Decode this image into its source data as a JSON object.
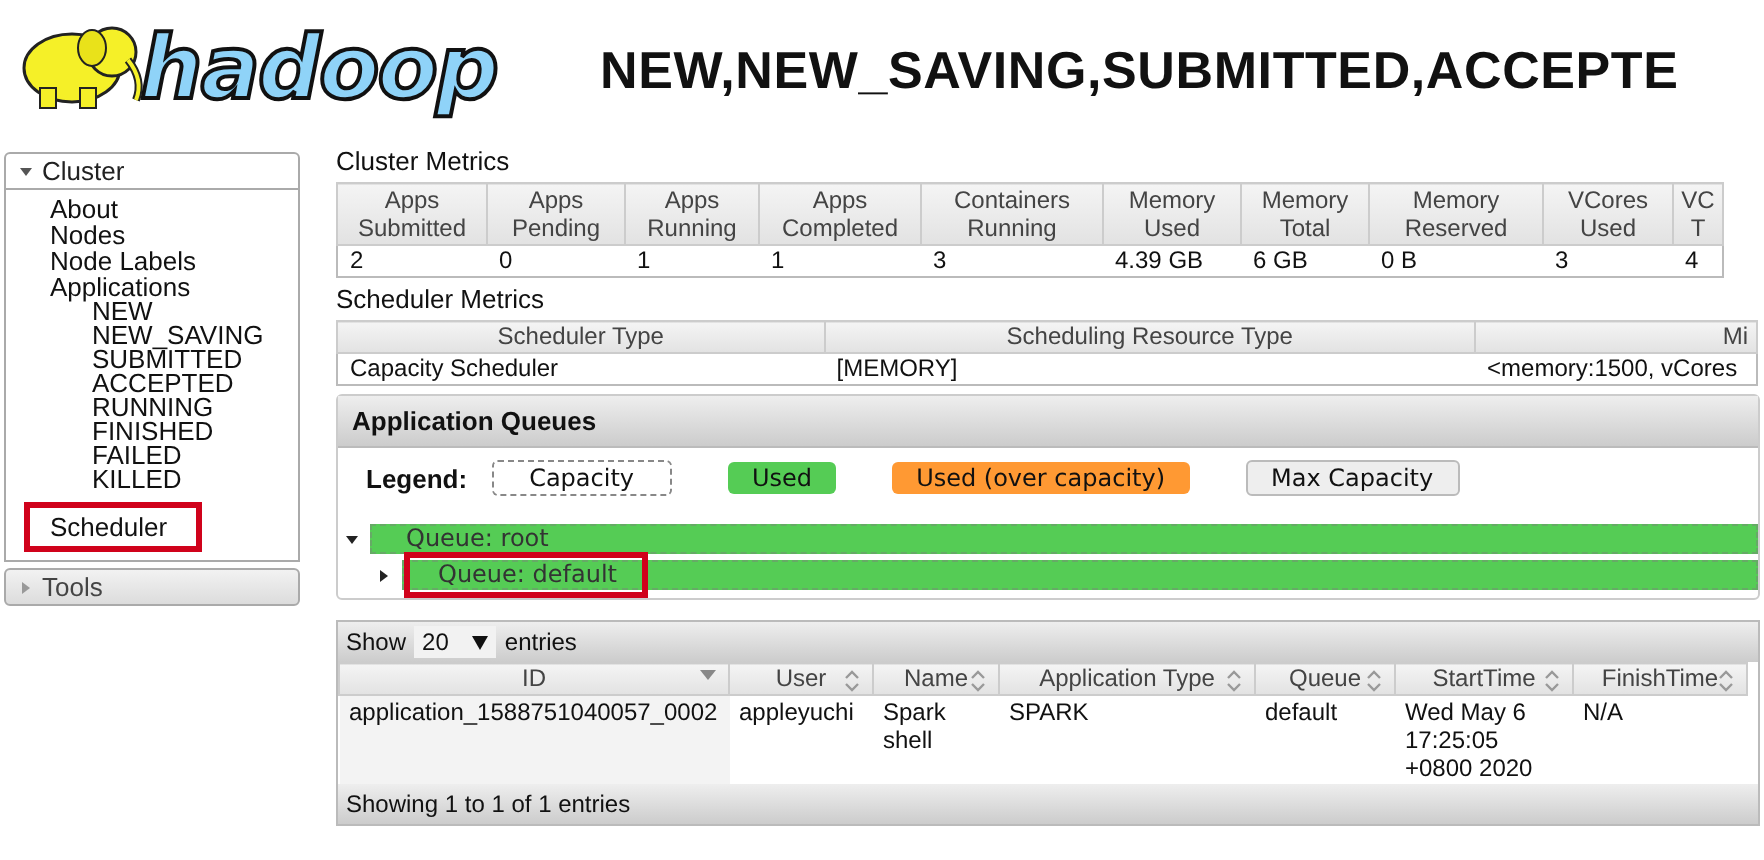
{
  "header": {
    "logo_text": "hadoop",
    "title": "NEW,NEW_SAVING,SUBMITTED,ACCEPTE"
  },
  "sidebar": {
    "sections": [
      {
        "label": "Cluster",
        "expanded": true,
        "items": [
          {
            "label": "About",
            "highlighted": false
          },
          {
            "label": "Nodes",
            "highlighted": false
          },
          {
            "label": "Node Labels",
            "highlighted": false
          },
          {
            "label": "Applications",
            "highlighted": false,
            "children": [
              {
                "label": "NEW"
              },
              {
                "label": "NEW_SAVING"
              },
              {
                "label": "SUBMITTED"
              },
              {
                "label": "ACCEPTED"
              },
              {
                "label": "RUNNING"
              },
              {
                "label": "FINISHED"
              },
              {
                "label": "FAILED"
              },
              {
                "label": "KILLED"
              }
            ]
          },
          {
            "label": "Scheduler",
            "highlighted": true
          }
        ]
      },
      {
        "label": "Tools",
        "expanded": false
      }
    ]
  },
  "cluster_metrics": {
    "title": "Cluster Metrics",
    "columns": [
      "Apps Submitted",
      "Apps Pending",
      "Apps Running",
      "Apps Completed",
      "Containers Running",
      "Memory Used",
      "Memory Total",
      "Memory Reserved",
      "VCores Used",
      "VC T"
    ],
    "rows": [
      [
        "2",
        "0",
        "1",
        "1",
        "3",
        "4.39 GB",
        "6 GB",
        "0 B",
        "3",
        "4"
      ]
    ]
  },
  "scheduler_metrics": {
    "title": "Scheduler Metrics",
    "columns": [
      "Scheduler Type",
      "Scheduling Resource Type",
      "Mi"
    ],
    "rows": [
      [
        "Capacity Scheduler",
        "[MEMORY]",
        "<memory:1500, vCores"
      ]
    ]
  },
  "application_queues": {
    "title": "Application Queues",
    "legend_label": "Legend:",
    "legend": [
      {
        "label": "Capacity",
        "kind": "capacity"
      },
      {
        "label": "Used",
        "kind": "used"
      },
      {
        "label": "Used (over capacity)",
        "kind": "over"
      },
      {
        "label": "Max Capacity",
        "kind": "max"
      }
    ],
    "queues": [
      {
        "label": "Queue: root",
        "expanded": true,
        "highlighted": false,
        "children": [
          {
            "label": "Queue: default",
            "expanded": false,
            "highlighted": true
          }
        ]
      }
    ]
  },
  "applications": {
    "show_label": "Show",
    "page_size": "20",
    "entries_label": "entries",
    "columns": [
      {
        "label": "ID",
        "sorted": true
      },
      {
        "label": "User",
        "sorted": false
      },
      {
        "label": "Name",
        "sorted": false
      },
      {
        "label": "Application Type",
        "sorted": false
      },
      {
        "label": "Queue",
        "sorted": false
      },
      {
        "label": "StartTime",
        "sorted": false
      },
      {
        "label": "FinishTime",
        "sorted": false
      }
    ],
    "rows": [
      [
        "application_1588751040057_0002",
        "appleyuchi",
        "Spark shell",
        "SPARK",
        "default",
        "Wed May 6 17:25:05 +0800 2020",
        "N/A"
      ]
    ],
    "footer": "Showing 1 to 1 of 1 entries"
  }
}
